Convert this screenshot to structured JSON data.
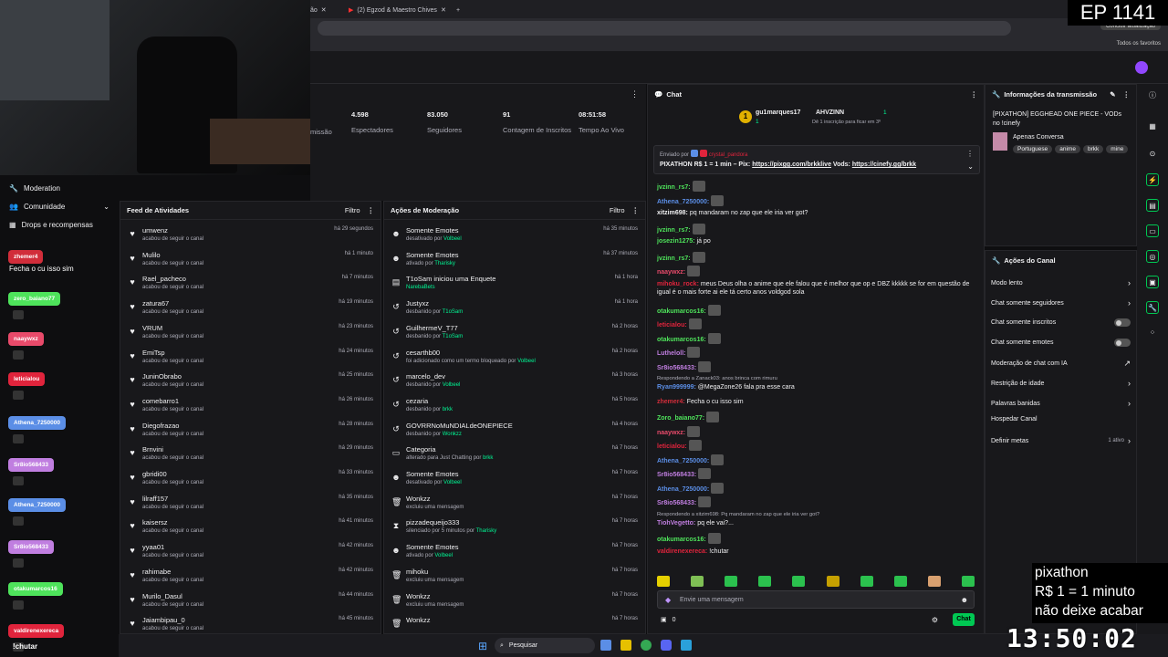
{
  "overlay": {
    "episode": "EP 1141",
    "pix_line1": "pixathon",
    "pix_line2": "R$ 1 = 1 minuto",
    "pix_line3": "não deixe acabar",
    "clock": "13:50:02"
  },
  "browser": {
    "tab1": "ão",
    "tab2": "(2) Egzod & Maestro Chives",
    "update_label": "Concluir atualização",
    "bookmarks_label": "Todos os favoritos"
  },
  "sidebar": {
    "moderation": "Moderation",
    "community": "Comunidade",
    "drops": "Drops e recompensas",
    "chat_users": [
      {
        "name": "zhemer4",
        "color": "#d12d3a"
      },
      {
        "name": "zero_baiano77",
        "color": "#4ee35b"
      },
      {
        "name": "naaywxz",
        "color": "#e84a6a"
      },
      {
        "name": "leticialou",
        "color": "#e0243c"
      },
      {
        "name": "Athena_7250000",
        "color": "#5b8ee6"
      },
      {
        "name": "Sr8io568433",
        "color": "#c07ee0"
      },
      {
        "name": "Athena_7250000",
        "color": "#5b8ee6"
      },
      {
        "name": "Sr8io568433",
        "color": "#c07ee0"
      },
      {
        "name": "otakumarcos16",
        "color": "#4ee35b"
      },
      {
        "name": "valdirenexereca",
        "color": "#e0243c"
      }
    ],
    "popup_msg": "Fecha o cu isso sim",
    "bottom_msg": "!chutar"
  },
  "stats": [
    {
      "value": "4.598",
      "label": "Espectadores"
    },
    {
      "value": "83.050",
      "label": "Seguidores"
    },
    {
      "value": "91",
      "label": "Contagem de Inscritos"
    },
    {
      "value": "08:51:58",
      "label": "Tempo Ao Vivo"
    }
  ],
  "stats_partial": "missão",
  "feed": {
    "title": "Feed de Atividades",
    "filter": "Filtro",
    "items": [
      {
        "name": "umwenz",
        "sub": "acabou de seguir o canal",
        "time": "há 29 segundos"
      },
      {
        "name": "Mulilo",
        "sub": "acabou de seguir o canal",
        "time": "há 1 minuto"
      },
      {
        "name": "Rael_pacheco",
        "sub": "acabou de seguir o canal",
        "time": "há 7 minutos"
      },
      {
        "name": "zatura67",
        "sub": "acabou de seguir o canal",
        "time": "há 19 minutos"
      },
      {
        "name": "VRUM",
        "sub": "acabou de seguir o canal",
        "time": "há 23 minutos"
      },
      {
        "name": "EmiTsp",
        "sub": "acabou de seguir o canal",
        "time": "há 24 minutos"
      },
      {
        "name": "JuninObrabo",
        "sub": "acabou de seguir o canal",
        "time": "há 25 minutos"
      },
      {
        "name": "comebarro1",
        "sub": "acabou de seguir o canal",
        "time": "há 26 minutos"
      },
      {
        "name": "Diegofrazao",
        "sub": "acabou de seguir o canal",
        "time": "há 28 minutos"
      },
      {
        "name": "Brnvini",
        "sub": "acabou de seguir o canal",
        "time": "há 29 minutos"
      },
      {
        "name": "gbridi00",
        "sub": "acabou de seguir o canal",
        "time": "há 33 minutos"
      },
      {
        "name": "lilraff157",
        "sub": "acabou de seguir o canal",
        "time": "há 35 minutos"
      },
      {
        "name": "kaisersz",
        "sub": "acabou de seguir o canal",
        "time": "há 41 minutos"
      },
      {
        "name": "yyaa01",
        "sub": "acabou de seguir o canal",
        "time": "há 42 minutos"
      },
      {
        "name": "rahimabe",
        "sub": "acabou de seguir o canal",
        "time": "há 42 minutos"
      },
      {
        "name": "Murilo_Dasul",
        "sub": "acabou de seguir o canal",
        "time": "há 44 minutos"
      },
      {
        "name": "Jaiambipau_0",
        "sub": "acabou de seguir o canal",
        "time": "há 45 minutos"
      }
    ]
  },
  "modactions": {
    "title": "Ações de Moderação",
    "filter": "Filtro",
    "items": [
      {
        "name": "Somente Emotes",
        "pre": "desativado por",
        "by": "Volbeel",
        "time": "há 35 minutos"
      },
      {
        "name": "Somente Emotes",
        "pre": "ativado por",
        "by": "Tharisky",
        "time": "há 37 minutos"
      },
      {
        "name": "T1oSam iniciou uma Enquete",
        "pre": "",
        "by": "NarebaBets",
        "time": "há 1 hora",
        "hl": true
      },
      {
        "name": "Justyxz",
        "pre": "desbanido por",
        "by": "T1oSam",
        "time": "há 1 hora"
      },
      {
        "name": "GuilhermeV_T77",
        "pre": "desbanido por",
        "by": "T1oSam",
        "time": "há 2 horas"
      },
      {
        "name": "cesarthb00",
        "pre": "foi adicionado como um termo bloqueado por",
        "by": "Volbeel",
        "time": "há 2 horas"
      },
      {
        "name": "marcelo_dev",
        "pre": "desbanido por",
        "by": "Volbeel",
        "time": "há 3 horas"
      },
      {
        "name": "cezaria",
        "pre": "desbanido por",
        "by": "brkk",
        "time": "há 5 horas"
      },
      {
        "name": "GOVRRNoMuNDIALdeONEPIECE",
        "pre": "desbanido por",
        "by": "Wonkzz",
        "time": "há 4 horas"
      },
      {
        "name": "Categoria",
        "pre": "alterado para Just Chatting por",
        "by": "brkk",
        "time": "há 7 horas"
      },
      {
        "name": "Somente Emotes",
        "pre": "desativado por",
        "by": "Volbeel",
        "time": "há 7 horas"
      },
      {
        "name": "Wonkzz",
        "pre": "excluiu uma mensagem",
        "by": "",
        "time": "há 7 horas"
      },
      {
        "name": "pizzadequeijo333",
        "pre": "silenciado por 5 minutos por",
        "by": "Tharisky",
        "time": "há 7 horas"
      },
      {
        "name": "Somente Emotes",
        "pre": "ativado por",
        "by": "Volbeel",
        "time": "há 7 horas"
      },
      {
        "name": "mihoku",
        "pre": "excluiu uma mensagem",
        "by": "",
        "time": "há 7 horas"
      },
      {
        "name": "Wonkzz",
        "pre": "excluiu uma mensagem",
        "by": "",
        "time": "há 7 horas"
      },
      {
        "name": "Wonkzz",
        "pre": "",
        "by": "",
        "time": "há 7 horas"
      }
    ]
  },
  "chat": {
    "title": "Chat",
    "leader1": "gu1marques17",
    "leader1_count": "1",
    "leader2": "AHVZINN",
    "leader2_count": "1",
    "leader_hint": "Dê 1 inscrição para ficar em 3º",
    "pinned_by_label": "Enviado por",
    "pinned_by": "crystal_pandora",
    "pinned_text": "PIXATHON R$ 1 = 1 min – Pix:",
    "pinned_link1": "https://pixgg.com/brkklive",
    "pinned_vods": "Vods:",
    "pinned_link2": "https://cinefy.gg/brkk",
    "messages": [
      {
        "user": "jvzinn_rs7:",
        "color": "#4ee35b",
        "text": "",
        "emote": true
      },
      {
        "user": "Athena_7250000:",
        "color": "#5b8ee6",
        "text": "",
        "emote": true
      },
      {
        "user": "xitzim698:",
        "color": "#efeff1",
        "text": "pq mandaram no zap que ele iria ver got?",
        "emote": false
      },
      {
        "user": "jvzinn_rs7:",
        "color": "#4ee35b",
        "text": "",
        "emote": true
      },
      {
        "user": "josezin1275:",
        "color": "#4ee35b",
        "text": "já po",
        "emote": false
      },
      {
        "user": "jvzinn_rs7:",
        "color": "#4ee35b",
        "text": "",
        "emote": true
      },
      {
        "user": "naaywxz:",
        "color": "#e84a6a",
        "text": "",
        "emote": true
      },
      {
        "user": "mihoku_rock:",
        "color": "#e0243c",
        "text": "meus Deus olha o anime que ele falou que é melhor que op e DBZ kkkkk se for em questão de igual é o mais forte ai ele tá certo anos voldgod sola",
        "emote": false
      },
      {
        "user": "otakumarcos16:",
        "color": "#4ee35b",
        "text": "",
        "emote": true
      },
      {
        "user": "leticialou:",
        "color": "#e0243c",
        "text": "",
        "emote": true
      },
      {
        "user": "otakumarcos16:",
        "color": "#4ee35b",
        "text": "",
        "emote": true
      },
      {
        "user": "Lutheloll:",
        "color": "#c07ee0",
        "text": "",
        "emote": true
      },
      {
        "user": "Sr8io568433:",
        "color": "#c07ee0",
        "text": "",
        "emote": true
      },
      {
        "user": "Ryan999999:",
        "color": "#5b8ee6",
        "text": "@MegaZone26 fala pra esse cara",
        "emote": false,
        "reply": "Respondendo a Zanack03: anos brinca com rimuru"
      },
      {
        "user": "zhemer4:",
        "color": "#d12d3a",
        "text": "Fecha o cu isso sim",
        "emote": false
      },
      {
        "user": "Zoro_baiano77:",
        "color": "#4ee35b",
        "text": "",
        "emote": true
      },
      {
        "user": "naaywxz:",
        "color": "#e84a6a",
        "text": "",
        "emote": true
      },
      {
        "user": "leticialou:",
        "color": "#e0243c",
        "text": "",
        "emote": true
      },
      {
        "user": "Athena_7250000:",
        "color": "#5b8ee6",
        "text": "",
        "emote": true
      },
      {
        "user": "Sr8io568433:",
        "color": "#c07ee0",
        "text": "",
        "emote": true
      },
      {
        "user": "Athena_7250000:",
        "color": "#5b8ee6",
        "text": "",
        "emote": true
      },
      {
        "user": "Sr8io568433:",
        "color": "#c07ee0",
        "text": "",
        "emote": true
      },
      {
        "user": "TiohVegetto:",
        "color": "#c07ee0",
        "text": "pq ele vai?...",
        "emote": false,
        "reply": "Respondendo a xitzim698: Pq mandaram no zap que ele iria ver got?"
      },
      {
        "user": "otakumarcos16:",
        "color": "#4ee35b",
        "text": "",
        "emote": true
      },
      {
        "user": "valdirenexereca:",
        "color": "#e0243c",
        "text": "!chutar",
        "emote": false
      }
    ],
    "input_placeholder": "Envie uma mensagem",
    "points": "0",
    "send": "Chat"
  },
  "info": {
    "title": "Informações da transmissão",
    "stream_title": "[PIXATHON] EGGHEAD ONE PIECE - VODs no !cinefy",
    "category": "Apenas Conversa",
    "tags": [
      "Portuguese",
      "anime",
      "brkk",
      "mine"
    ]
  },
  "actions": {
    "title": "Ações do Canal",
    "items": [
      {
        "label": "Modo lento",
        "kind": "chev"
      },
      {
        "label": "Chat somente seguidores",
        "kind": "chev"
      },
      {
        "label": "Chat somente inscritos",
        "kind": "toggle"
      },
      {
        "label": "Chat somente emotes",
        "kind": "toggle"
      },
      {
        "label": "Moderação de chat com IA",
        "kind": "ext"
      },
      {
        "label": "Restrição de idade",
        "kind": "chev"
      },
      {
        "label": "Palavras banidas",
        "kind": "chev"
      },
      {
        "label": "Hospedar Canal",
        "kind": "none"
      },
      {
        "label": "Definir metas",
        "kind": "meta",
        "extra": "1 ativo"
      }
    ]
  },
  "taskbar": {
    "search": "Pesquisar"
  }
}
